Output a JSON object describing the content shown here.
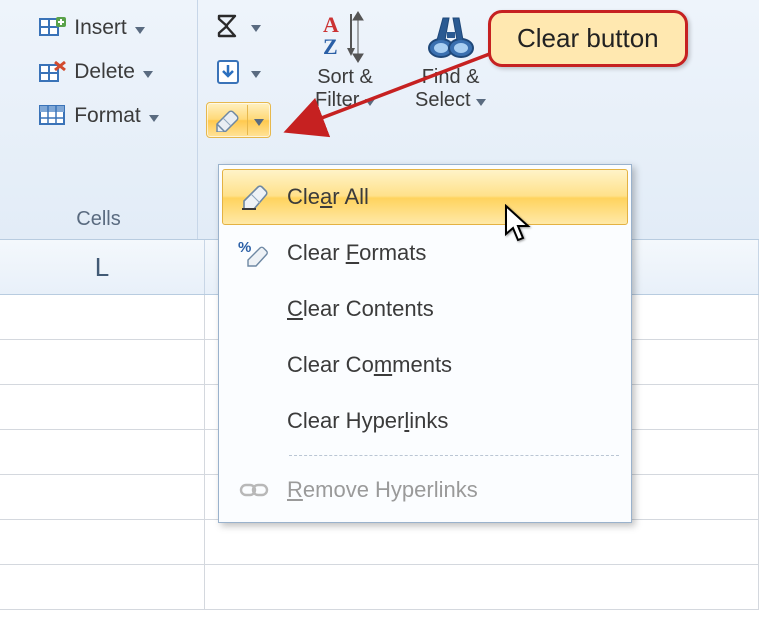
{
  "ribbon": {
    "cells_group": {
      "label": "Cells",
      "insert": "Insert",
      "delete": "Delete",
      "format": "Format"
    },
    "editing_group": {
      "sort_filter": "Sort &\nFilter",
      "find_select": "Find &\nSelect"
    }
  },
  "clear_menu": {
    "clear_all": "Clear All",
    "clear_formats": "Clear Formats",
    "clear_contents": "Clear Contents",
    "clear_comments": "Clear Comments",
    "clear_hyperlinks": "Clear Hyperlinks",
    "remove_hyperlinks": "Remove Hyperlinks"
  },
  "columns": {
    "l": "L"
  },
  "callout": {
    "text": "Clear button"
  },
  "icons": {
    "insert": "insert-cells-icon",
    "delete": "delete-cells-icon",
    "format": "format-cells-icon",
    "autosum": "autosum-icon",
    "fill": "fill-down-icon",
    "clear": "eraser-icon",
    "sort": "sort-az-icon",
    "find": "binoculars-icon",
    "percent_eraser": "percent-eraser-icon",
    "link": "hyperlink-icon"
  }
}
